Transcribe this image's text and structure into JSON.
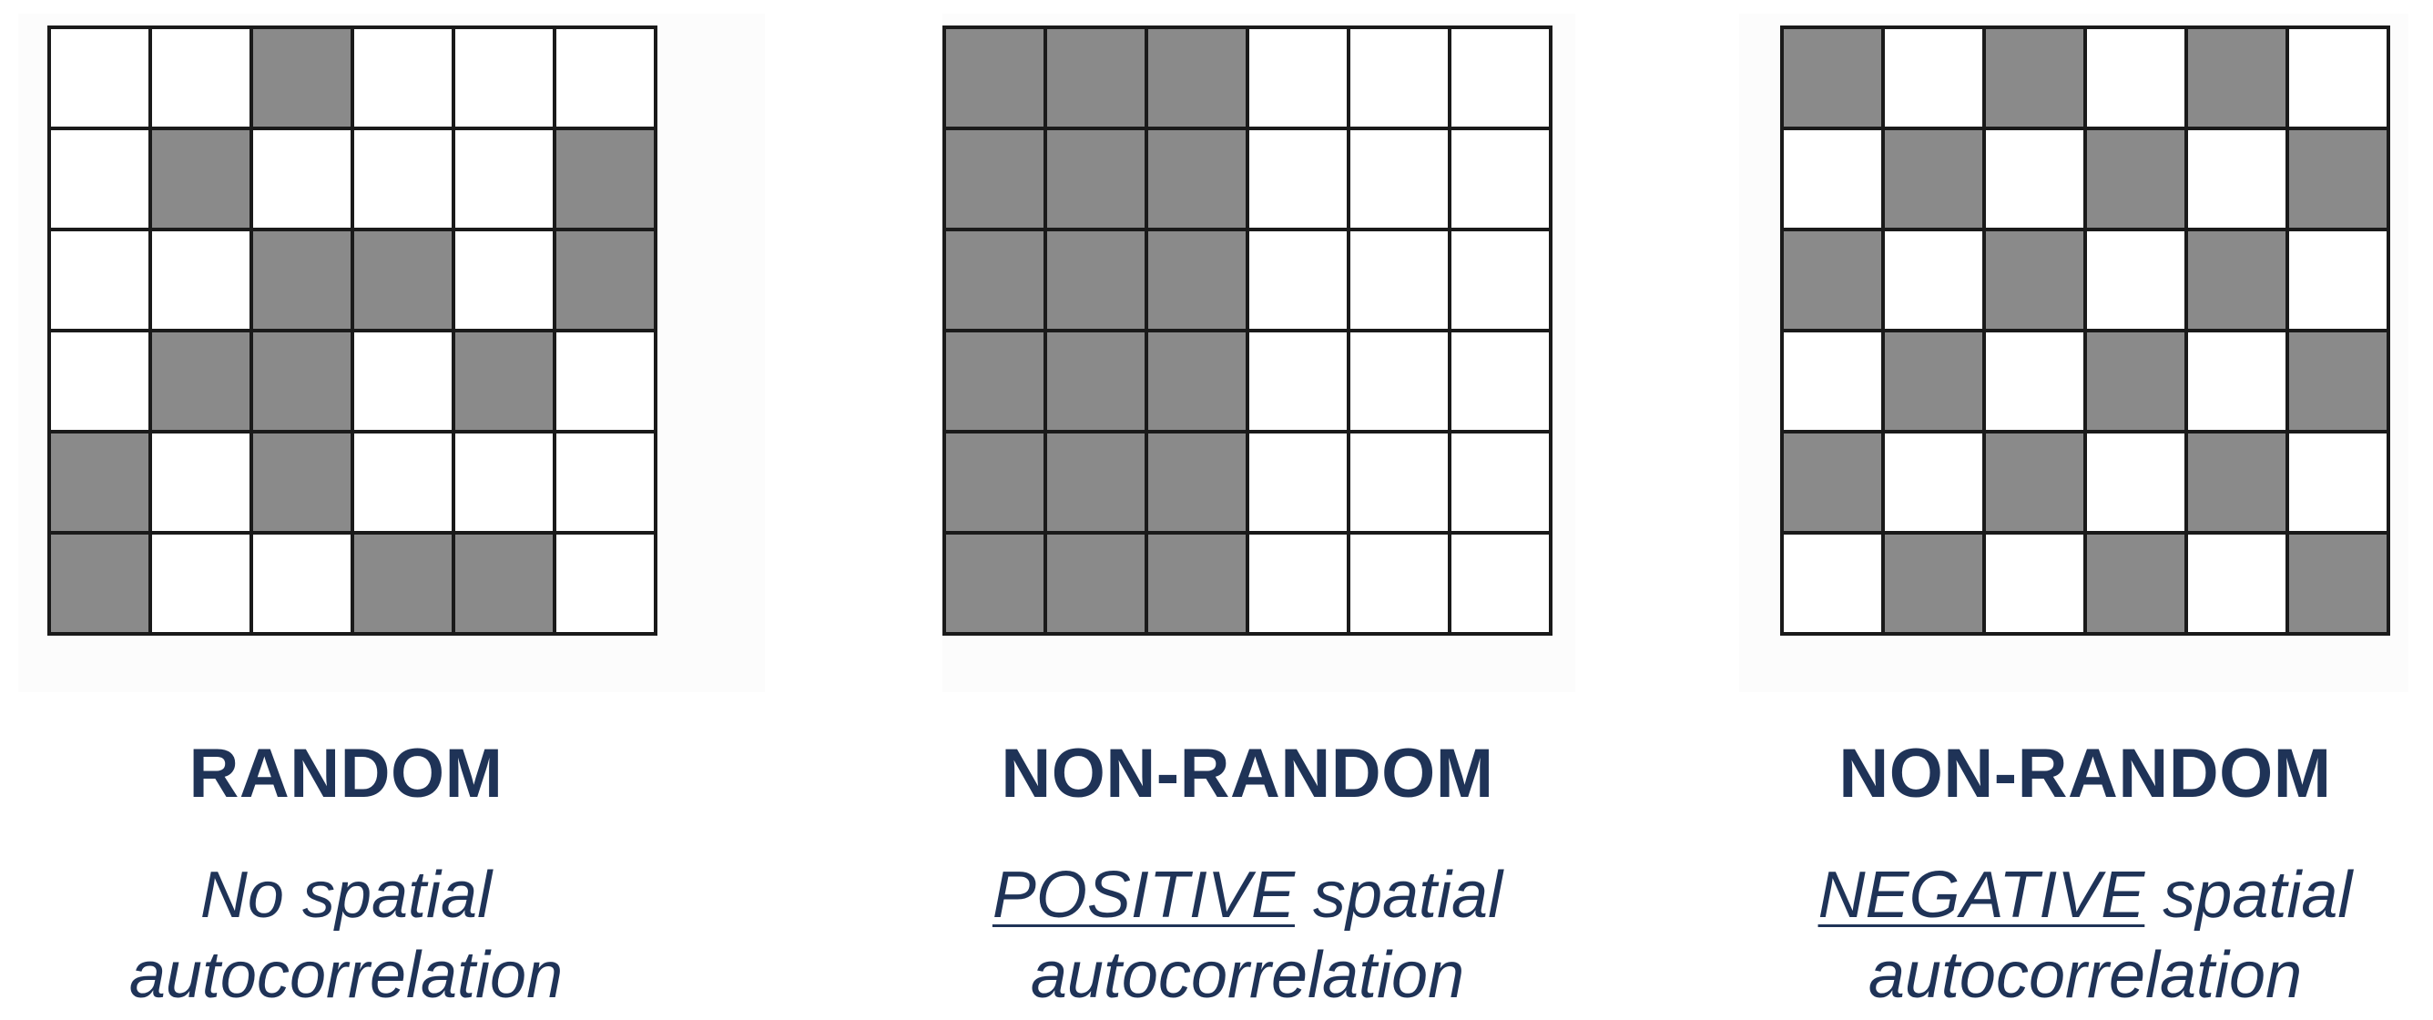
{
  "panels": [
    {
      "heading": "RANDOM",
      "caption_emphasis": "",
      "caption_line1": "No spatial",
      "caption_line2": "autocorrelation",
      "grid": [
        [
          0,
          0,
          1,
          0,
          0,
          0
        ],
        [
          0,
          1,
          0,
          0,
          0,
          1
        ],
        [
          0,
          0,
          1,
          1,
          0,
          1
        ],
        [
          0,
          1,
          1,
          0,
          1,
          0
        ],
        [
          1,
          0,
          1,
          0,
          0,
          0
        ],
        [
          1,
          0,
          0,
          1,
          1,
          0
        ]
      ]
    },
    {
      "heading": "NON-RANDOM",
      "caption_emphasis": "POSITIVE",
      "caption_line1": " spatial",
      "caption_line2": "autocorrelation",
      "grid": [
        [
          1,
          1,
          1,
          0,
          0,
          0
        ],
        [
          1,
          1,
          1,
          0,
          0,
          0
        ],
        [
          1,
          1,
          1,
          0,
          0,
          0
        ],
        [
          1,
          1,
          1,
          0,
          0,
          0
        ],
        [
          1,
          1,
          1,
          0,
          0,
          0
        ],
        [
          1,
          1,
          1,
          0,
          0,
          0
        ]
      ]
    },
    {
      "heading": "NON-RANDOM",
      "caption_emphasis": "NEGATIVE",
      "caption_line1": " spatial",
      "caption_line2": "autocorrelation",
      "grid": [
        [
          1,
          0,
          1,
          0,
          1,
          0
        ],
        [
          0,
          1,
          0,
          1,
          0,
          1
        ],
        [
          1,
          0,
          1,
          0,
          1,
          0
        ],
        [
          0,
          1,
          0,
          1,
          0,
          1
        ],
        [
          1,
          0,
          1,
          0,
          1,
          0
        ],
        [
          0,
          1,
          0,
          1,
          0,
          1
        ]
      ]
    }
  ],
  "colors": {
    "filled_cell": "#8a8a8a",
    "empty_cell": "#ffffff",
    "grid_line": "#1a1a1a",
    "text": "#1f3357"
  }
}
